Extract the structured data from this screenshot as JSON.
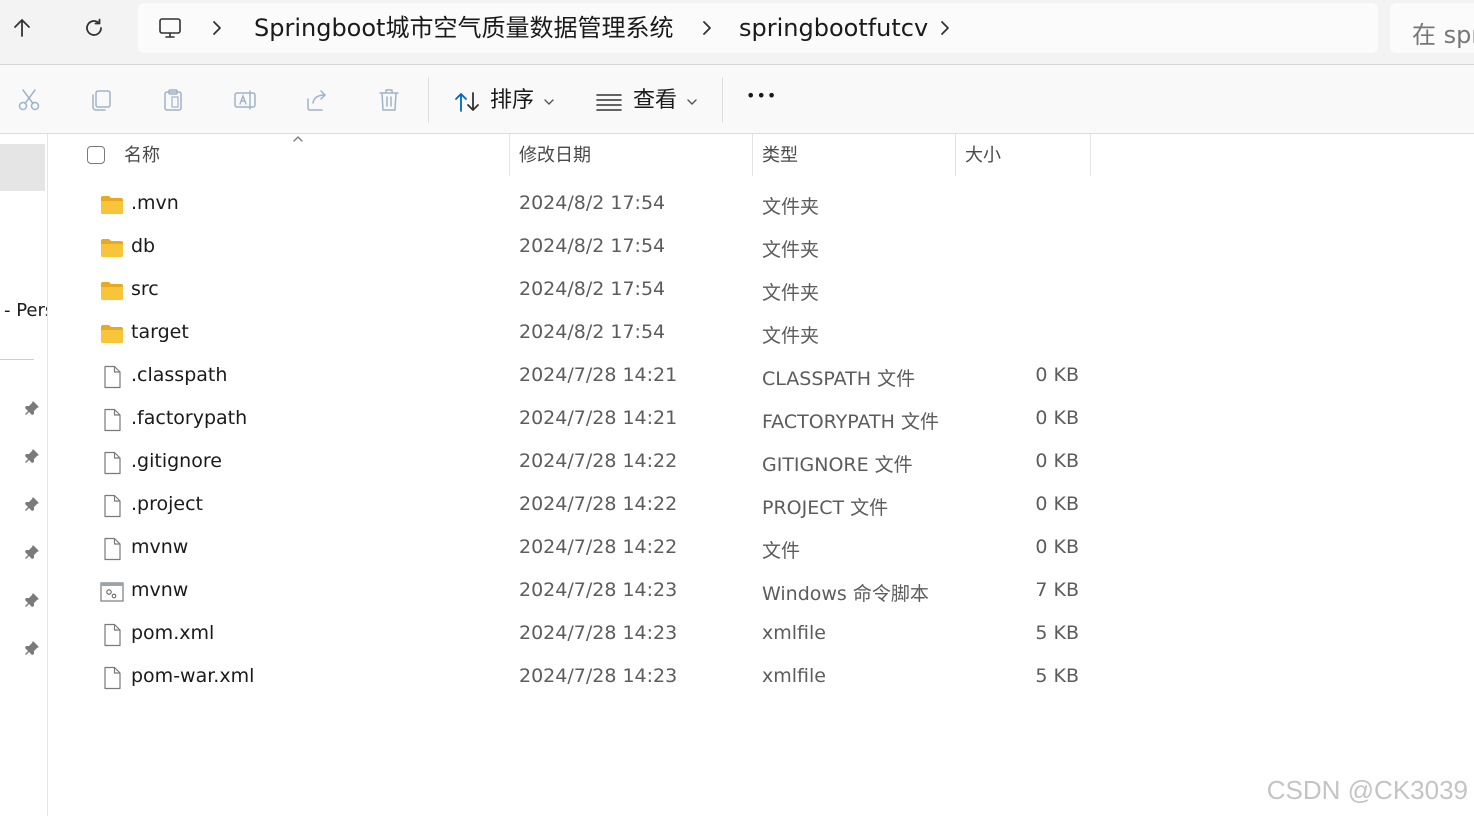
{
  "address_bar": {
    "crumbs": [
      "Springboot城市空气质量数据管理系统",
      "springbootfutcv"
    ],
    "search_placeholder": "在 spr"
  },
  "toolbar": {
    "sort_label": "排序",
    "view_label": "查看",
    "more_label": "•••"
  },
  "nav_pane": {
    "visible_text": "- Pers"
  },
  "columns": {
    "name": "名称",
    "modified": "修改日期",
    "type": "类型",
    "size": "大小"
  },
  "files": [
    {
      "name": ".mvn",
      "modified": "2024/8/2 17:54",
      "type": "文件夹",
      "size": "",
      "icon": "folder-icon"
    },
    {
      "name": "db",
      "modified": "2024/8/2 17:54",
      "type": "文件夹",
      "size": "",
      "icon": "folder-icon"
    },
    {
      "name": "src",
      "modified": "2024/8/2 17:54",
      "type": "文件夹",
      "size": "",
      "icon": "folder-icon"
    },
    {
      "name": "target",
      "modified": "2024/8/2 17:54",
      "type": "文件夹",
      "size": "",
      "icon": "folder-icon"
    },
    {
      "name": ".classpath",
      "modified": "2024/7/28 14:21",
      "type": "CLASSPATH 文件",
      "size": "0 KB",
      "icon": "file-icon"
    },
    {
      "name": ".factorypath",
      "modified": "2024/7/28 14:21",
      "type": "FACTORYPATH 文件",
      "size": "0 KB",
      "icon": "file-icon"
    },
    {
      "name": ".gitignore",
      "modified": "2024/7/28 14:22",
      "type": "GITIGNORE 文件",
      "size": "0 KB",
      "icon": "file-icon"
    },
    {
      "name": ".project",
      "modified": "2024/7/28 14:22",
      "type": "PROJECT 文件",
      "size": "0 KB",
      "icon": "file-icon"
    },
    {
      "name": "mvnw",
      "modified": "2024/7/28 14:22",
      "type": "文件",
      "size": "0 KB",
      "icon": "file-icon"
    },
    {
      "name": "mvnw",
      "modified": "2024/7/28 14:23",
      "type": "Windows 命令脚本",
      "size": "7 KB",
      "icon": "script-icon"
    },
    {
      "name": "pom.xml",
      "modified": "2024/7/28 14:23",
      "type": "xmlfile",
      "size": "5 KB",
      "icon": "file-icon"
    },
    {
      "name": "pom-war.xml",
      "modified": "2024/7/28 14:23",
      "type": "xmlfile",
      "size": "5 KB",
      "icon": "file-icon"
    }
  ],
  "watermark": "CSDN @CK3039",
  "colors": {
    "folder": "#f8c53a",
    "accent": "#0067c0",
    "text": "#1a1a1a",
    "muted": "#5c5c5c"
  }
}
